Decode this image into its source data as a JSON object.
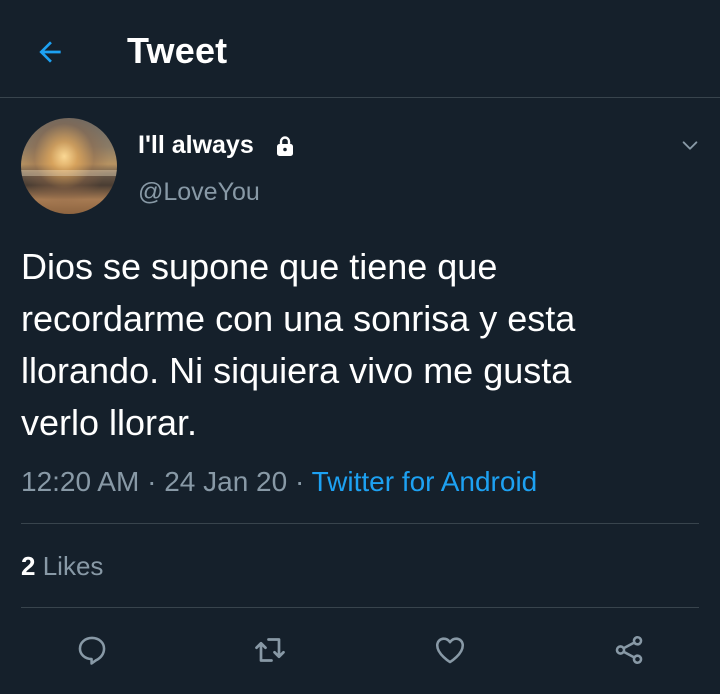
{
  "header": {
    "title": "Tweet",
    "back_icon": "arrow-left-icon"
  },
  "tweet": {
    "display_name": "I'll always",
    "protected_icon": "lock-icon",
    "handle": "@LoveYou",
    "text": "Dios se supone que tiene que\nrecordarme con una sonrisa y esta\nllorando. Ni siquiera vivo me gusta\nverlo llorar.",
    "time": "12:20 AM",
    "dot": "·",
    "date": "24 Jan 20",
    "source": "Twitter for Android"
  },
  "stats": {
    "likes_count": "2",
    "likes_label": "Likes"
  },
  "actions": {
    "reply_icon": "reply-icon",
    "retweet_icon": "retweet-icon",
    "like_icon": "heart-icon",
    "share_icon": "share-icon"
  },
  "colors": {
    "background": "#15202b",
    "accent": "#1da1f2",
    "secondary_text": "#8899a6",
    "divider": "#38444d"
  }
}
